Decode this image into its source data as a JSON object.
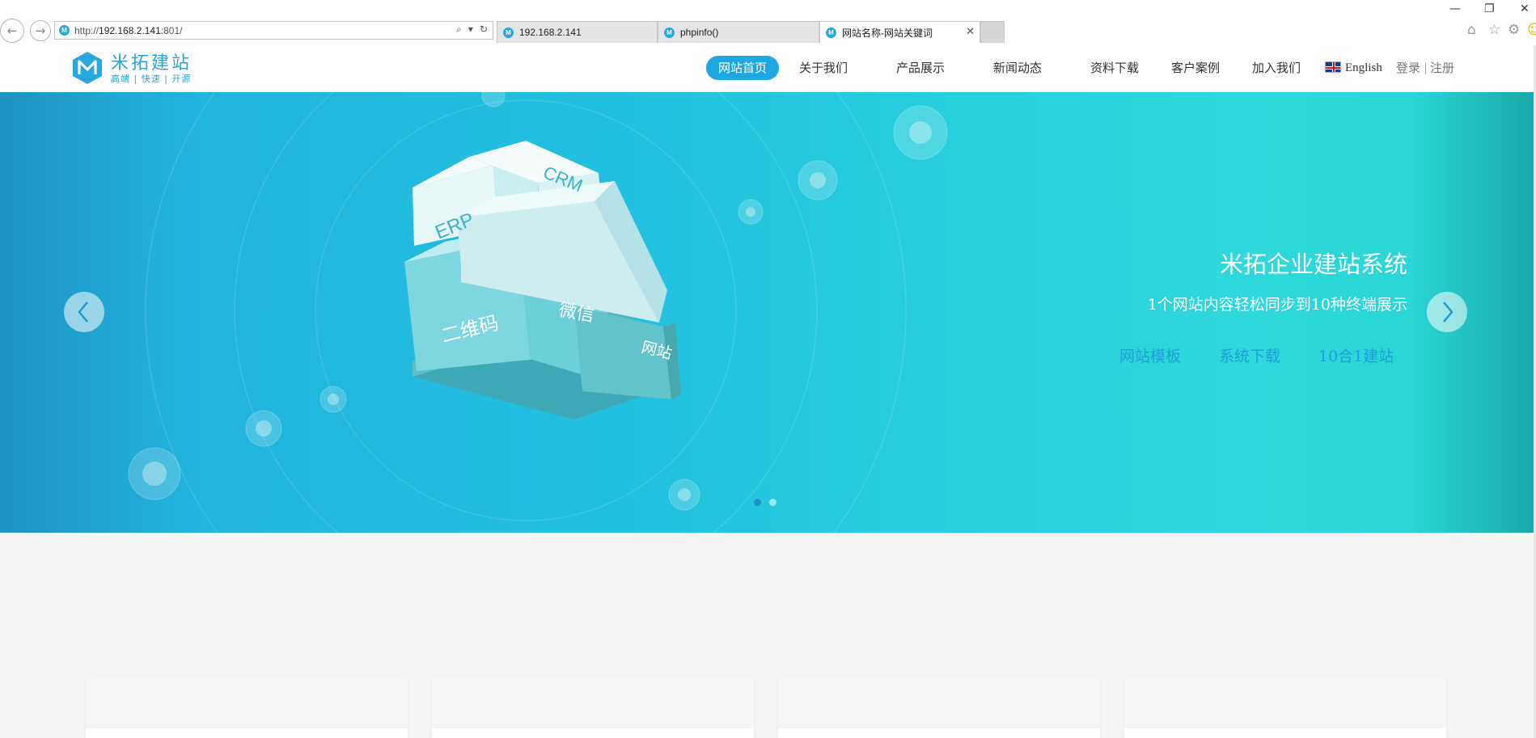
{
  "browser": {
    "address": {
      "scheme": "http://",
      "host": "192.168.2.141",
      "rest": ":801/"
    },
    "tabs": [
      {
        "label": "192.168.2.141"
      },
      {
        "label": "phpinfo()"
      },
      {
        "label": "网站名称-网站关键词",
        "close": "✕"
      }
    ],
    "window": {
      "minimize": "—",
      "restore": "❐",
      "close": "✕"
    },
    "toolbar": {
      "home": "⌂",
      "favorites": "☆",
      "settings": "⚙"
    }
  },
  "site": {
    "logo": {
      "name": "米拓建站",
      "slogan": "高端 | 快速 | 开源"
    },
    "menu": [
      {
        "label": "网站首页",
        "active": true
      },
      {
        "label": "关于我们"
      },
      {
        "label": "产品展示"
      },
      {
        "label": "新闻动态"
      },
      {
        "label": "资料下载"
      },
      {
        "label": "客户案例"
      },
      {
        "label": "加入我们"
      }
    ],
    "language": "English",
    "login": "登录",
    "register": "注册"
  },
  "banner": {
    "title": "米拓企业建站系统",
    "subtitle": "1个网站内容轻松同步到10种终端展示",
    "links": [
      "网站模板",
      "系统下载",
      "10合1建站"
    ],
    "cube_labels": {
      "erp": "ERP",
      "crm": "CRM",
      "qrcode": "二维码",
      "wechat": "微信",
      "website": "网站"
    },
    "slides": {
      "count": 2,
      "active": 1
    }
  },
  "colors": {
    "accent": "#1ea8e1",
    "banner_link": "#1ea0d8"
  }
}
